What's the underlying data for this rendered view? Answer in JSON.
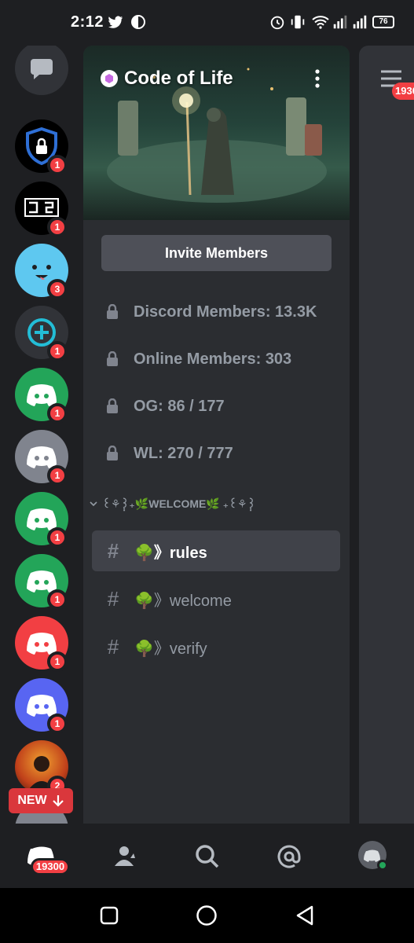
{
  "status_bar": {
    "time": "2:12",
    "battery": "76"
  },
  "servers": [
    {
      "name": "chat",
      "badge": ""
    },
    {
      "name": "security-shield",
      "badge": "1"
    },
    {
      "name": "cb-logo",
      "badge": "1"
    },
    {
      "name": "blue-face",
      "badge": "3"
    },
    {
      "name": "add-circle",
      "badge": "1"
    },
    {
      "name": "discord-green-1",
      "badge": "1"
    },
    {
      "name": "discord-grey",
      "badge": "1"
    },
    {
      "name": "discord-green-2",
      "badge": "1"
    },
    {
      "name": "discord-green-3",
      "badge": "1"
    },
    {
      "name": "discord-red",
      "badge": "1"
    },
    {
      "name": "discord-blurple",
      "badge": "1"
    },
    {
      "name": "avatar-person",
      "badge": "2"
    }
  ],
  "new_pill": {
    "label": "NEW"
  },
  "server": {
    "title": "Code of Life",
    "invite_label": "Invite Members",
    "stats": [
      {
        "label": "Discord Members: 13.3K"
      },
      {
        "label": "Online Members: 303"
      },
      {
        "label": "OG: 86 / 177"
      },
      {
        "label": "WL: 270 / 777"
      }
    ],
    "category": "꒰⚘݄꒱₊🌿WELCOME🌿 ₊꒰⚘݄꒱",
    "channels": [
      {
        "name": "🌳》rules",
        "active": true
      },
      {
        "name": "🌳》welcome",
        "active": false
      },
      {
        "name": "🌳》verify",
        "active": false
      }
    ]
  },
  "peek": {
    "badge": "1930"
  },
  "bottom_nav": {
    "home_badge": "19300"
  },
  "colors": {
    "accent": "#5865f2",
    "danger": "#f23f43",
    "green": "#23a559",
    "panel": "#2b2d31"
  }
}
